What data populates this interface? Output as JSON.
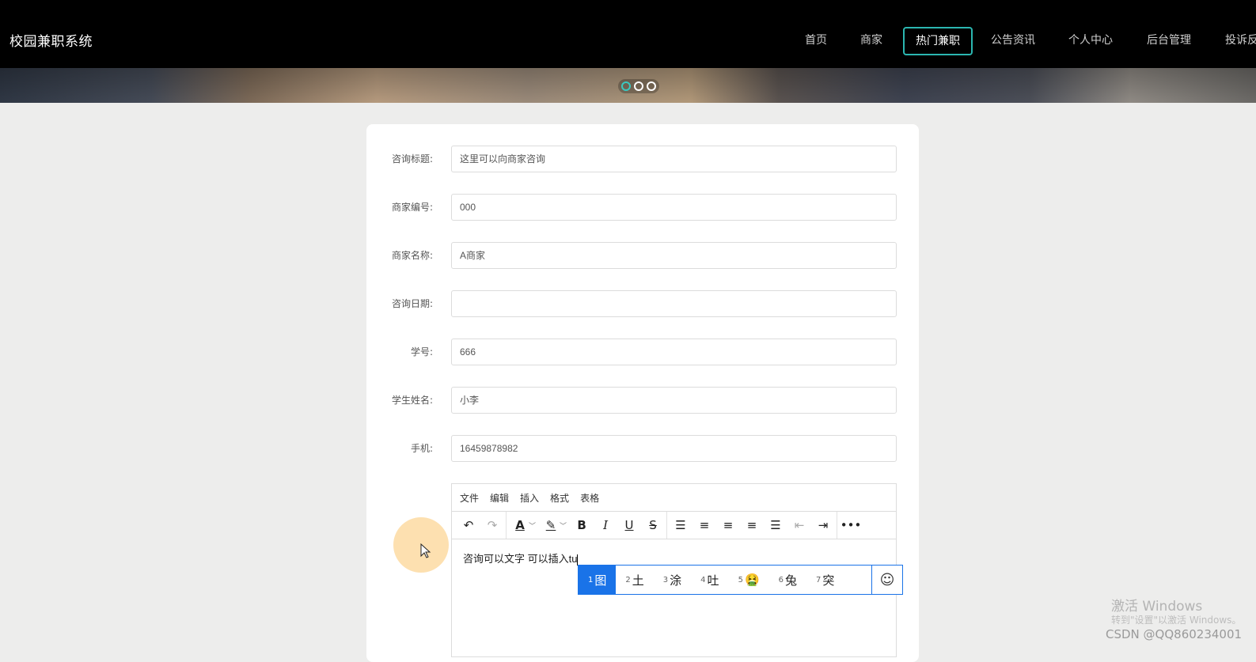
{
  "header": {
    "brand": "校园兼职系统",
    "nav": [
      {
        "label": "首页",
        "active": false
      },
      {
        "label": "商家",
        "active": false
      },
      {
        "label": "热门兼职",
        "active": true
      },
      {
        "label": "公告资讯",
        "active": false
      },
      {
        "label": "个人中心",
        "active": false
      },
      {
        "label": "后台管理",
        "active": false
      },
      {
        "label": "投诉反",
        "active": false
      }
    ],
    "accent_color": "#2bb6b0"
  },
  "carousel": {
    "dot_count": 3,
    "active_index": 0
  },
  "form": {
    "title_label": "咨询标题:",
    "title_value": "这里可以向商家咨询",
    "merchant_no_label": "商家编号:",
    "merchant_no_value": "000",
    "merchant_name_label": "商家名称:",
    "merchant_name_value": "A商家",
    "date_label": "咨询日期:",
    "date_value": "",
    "student_no_label": "学号:",
    "student_no_value": "666",
    "student_name_label": "学生姓名:",
    "student_name_value": "小李",
    "phone_label": "手机:",
    "phone_value": "16459878982"
  },
  "editor": {
    "menu": [
      "文件",
      "编辑",
      "插入",
      "格式",
      "表格"
    ],
    "toolbar_icons": [
      "undo-icon",
      "redo-icon",
      "font-color-icon",
      "highlight-color-icon",
      "bold-icon",
      "italic-icon",
      "underline-icon",
      "strikethrough-icon",
      "line-height-icon",
      "align-left-icon",
      "align-center-icon",
      "align-right-icon",
      "align-justify-icon",
      "outdent-icon",
      "indent-icon",
      "more-icon"
    ],
    "content": "咨询可以文字  可以插入tu"
  },
  "ime": {
    "candidates": [
      {
        "n": "1",
        "text": "图",
        "selected": true
      },
      {
        "n": "2",
        "text": "土",
        "selected": false
      },
      {
        "n": "3",
        "text": "涂",
        "selected": false
      },
      {
        "n": "4",
        "text": "吐",
        "selected": false
      },
      {
        "n": "5",
        "text": "🤮",
        "selected": false
      },
      {
        "n": "6",
        "text": "兔",
        "selected": false
      },
      {
        "n": "7",
        "text": "突",
        "selected": false
      }
    ],
    "emoji_button": "☺",
    "highlight_color": "#1a73e8"
  },
  "watermark": {
    "line1": "激活 Windows",
    "line2": "转到\"设置\"以激活 Windows。",
    "line3": "CSDN @QQ860234001"
  }
}
